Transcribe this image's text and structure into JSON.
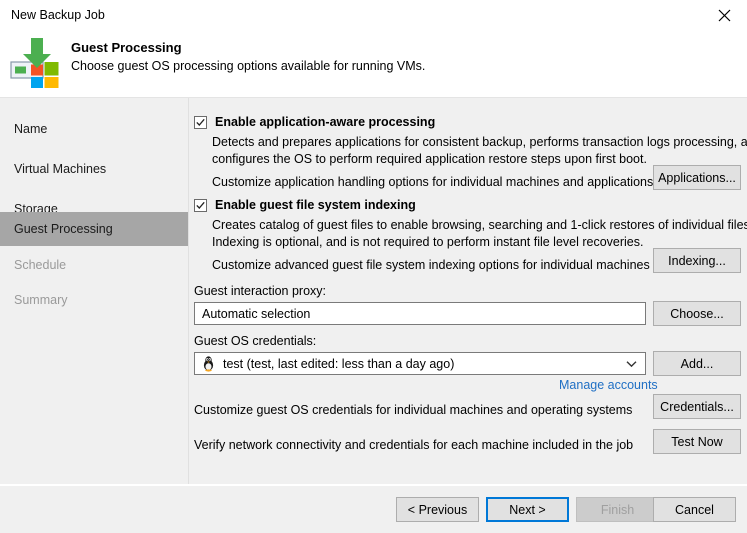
{
  "window": {
    "title": "New Backup Job",
    "close_icon": "close-icon"
  },
  "header": {
    "icon": "windows-guest-processing-icon",
    "title": "Guest Processing",
    "subtitle": "Choose guest OS processing options available for running VMs."
  },
  "sidebar": {
    "items": [
      {
        "label": "Name",
        "state": "normal"
      },
      {
        "label": "Virtual Machines",
        "state": "normal"
      },
      {
        "label": "Storage",
        "state": "normal"
      },
      {
        "label": "Guest Processing",
        "state": "selected"
      },
      {
        "label": "Schedule",
        "state": "disabled"
      },
      {
        "label": "Summary",
        "state": "disabled"
      }
    ],
    "selected_bg": "#a6a6a6"
  },
  "main": {
    "app_aware": {
      "checkbox_checked": true,
      "label": "Enable application-aware processing",
      "desc_line1": "Detects and prepares applications for consistent backup, performs transaction logs processing, and",
      "desc_line2": "configures the OS to perform required application restore steps upon first boot.",
      "desc_line3": "Customize application handling options for individual machines and applications",
      "button": "Applications..."
    },
    "indexing": {
      "checkbox_checked": true,
      "label": "Enable guest file system indexing",
      "desc_line1": "Creates catalog of guest files to enable browsing, searching and 1-click restores of individual files.",
      "desc_line2": "Indexing is optional, and is not required to perform instant file level recoveries.",
      "desc_line3": "Customize advanced guest file system indexing options for individual machines",
      "button": "Indexing..."
    },
    "guest_proxy": {
      "label": "Guest interaction proxy:",
      "value": "Automatic selection",
      "button": "Choose..."
    },
    "guest_credentials": {
      "label": "Guest OS credentials:",
      "value": "test (test, last edited: less than a day ago)",
      "value_icon": "linux-penguin-icon",
      "dropdown_icon": "chevron-down-icon",
      "button": "Add...",
      "manage_link": "Manage accounts"
    },
    "customize_credentials": {
      "text": "Customize guest OS credentials for individual machines and operating systems",
      "button": "Credentials..."
    },
    "verify": {
      "text": "Verify network connectivity and credentials for each machine included in the job",
      "button": "Test Now"
    }
  },
  "footer": {
    "previous": "< Previous",
    "next": "Next >",
    "finish": "Finish",
    "cancel": "Cancel",
    "finish_disabled": true,
    "next_is_default": true,
    "accent": "#0078d7"
  }
}
